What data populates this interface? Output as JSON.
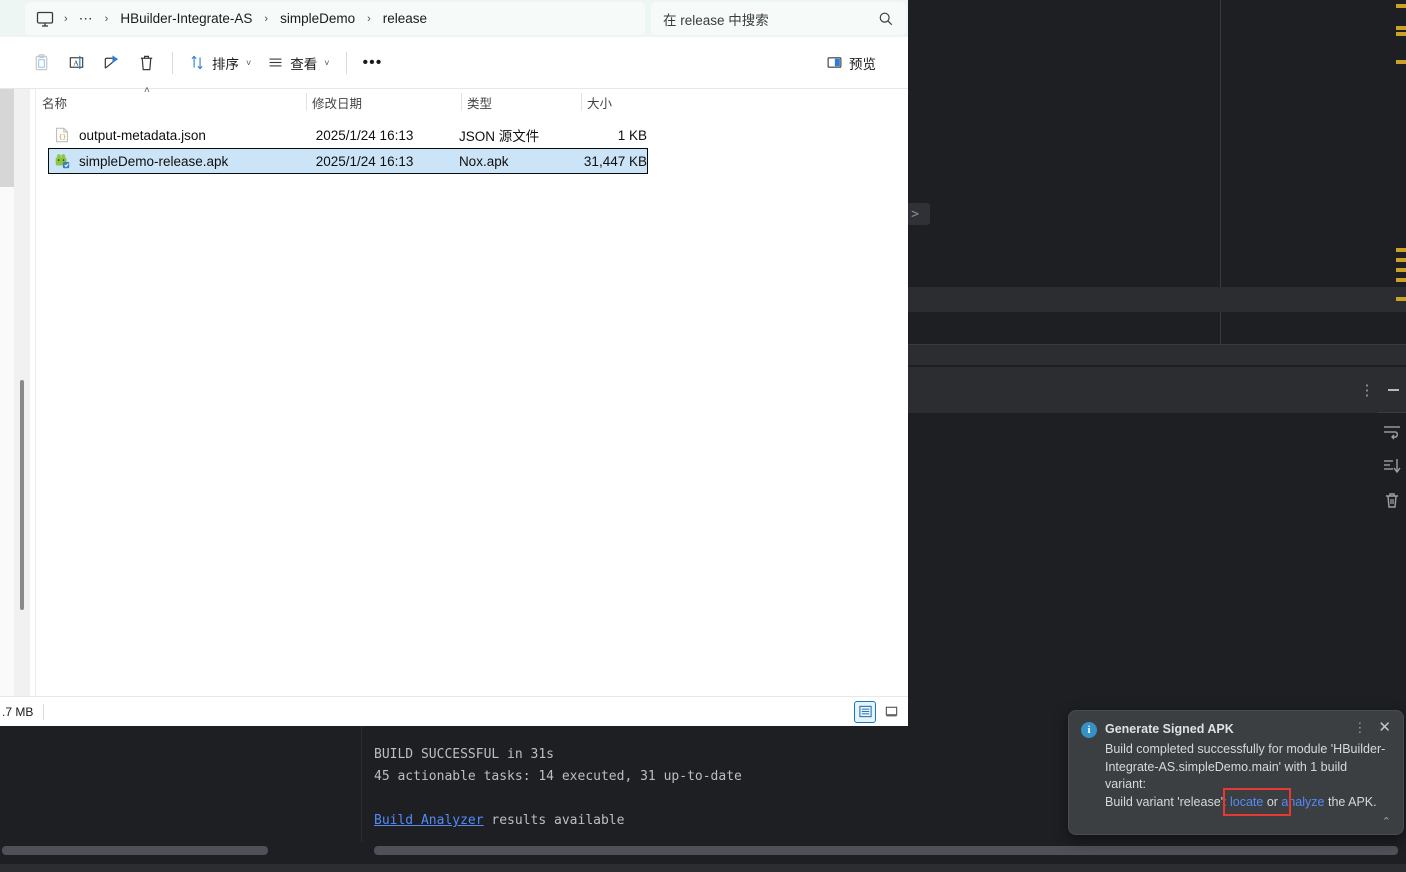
{
  "ide": {
    "toolwindow": {
      "kebab_label": "⋮",
      "minimize_label": ""
    },
    "gutter_icons": [
      "soft-wrap-icon",
      "scroll-to-end-icon",
      "clear-all-icon"
    ],
    "peek_chevron": ">",
    "console": {
      "line1": "BUILD SUCCESSFUL in 31s",
      "line2": "45 actionable tasks: 14 executed, 31 up-to-date",
      "line3_link": "Build Analyzer",
      "line3_rest": " results available"
    }
  },
  "explorer": {
    "breadcrumb": {
      "home_icon": "monitor-icon",
      "sep": "›",
      "ellipsis": "⋯",
      "items": [
        "HBuilder-Integrate-AS",
        "simpleDemo",
        "release"
      ]
    },
    "search": {
      "placeholder": "在 release 中搜索",
      "icon": "search-icon"
    },
    "toolbar": {
      "paste_label": "paste-icon",
      "rename_label": "rename-icon",
      "share_label": "share-icon",
      "delete_label": "delete-icon",
      "sort_label": "排序",
      "view_label": "查看",
      "more_label": "•••",
      "preview_label": "预览",
      "caret": "˅"
    },
    "columns": [
      {
        "key": "name",
        "label": "名称"
      },
      {
        "key": "date",
        "label": "修改日期"
      },
      {
        "key": "type",
        "label": "类型"
      },
      {
        "key": "size",
        "label": "大小"
      }
    ],
    "sort_arrow": "˄",
    "files": [
      {
        "icon": "json-file-icon",
        "name": "output-metadata.json",
        "date": "2025/1/24 16:13",
        "type": "JSON 源文件",
        "size": "1 KB",
        "selected": false
      },
      {
        "icon": "apk-file-icon",
        "name": "simpleDemo-release.apk",
        "date": "2025/1/24 16:13",
        "type": "Nox.apk",
        "size": "31,447 KB",
        "selected": true
      }
    ],
    "status": {
      "text": ".7 MB"
    },
    "view_toggles": [
      {
        "name": "details-view-button",
        "active": true
      },
      {
        "name": "large-icons-view-button",
        "active": false
      }
    ]
  },
  "notification": {
    "icon": "info-icon",
    "title": "Generate Signed APK",
    "body_1": "Build completed successfully for module 'HBuilder-Integrate-AS.simpleDemo.main' with 1 build variant:",
    "body_2_pre": "Build variant 'release': ",
    "link_locate": "locate",
    "body_2_mid": " or ",
    "link_analyze": "analyze",
    "body_2_post": " the APK.",
    "kebab": "⋮",
    "close": "✕",
    "expand": "⌃",
    "accent_color": "#548af7",
    "highlight_color": "#e53935"
  }
}
